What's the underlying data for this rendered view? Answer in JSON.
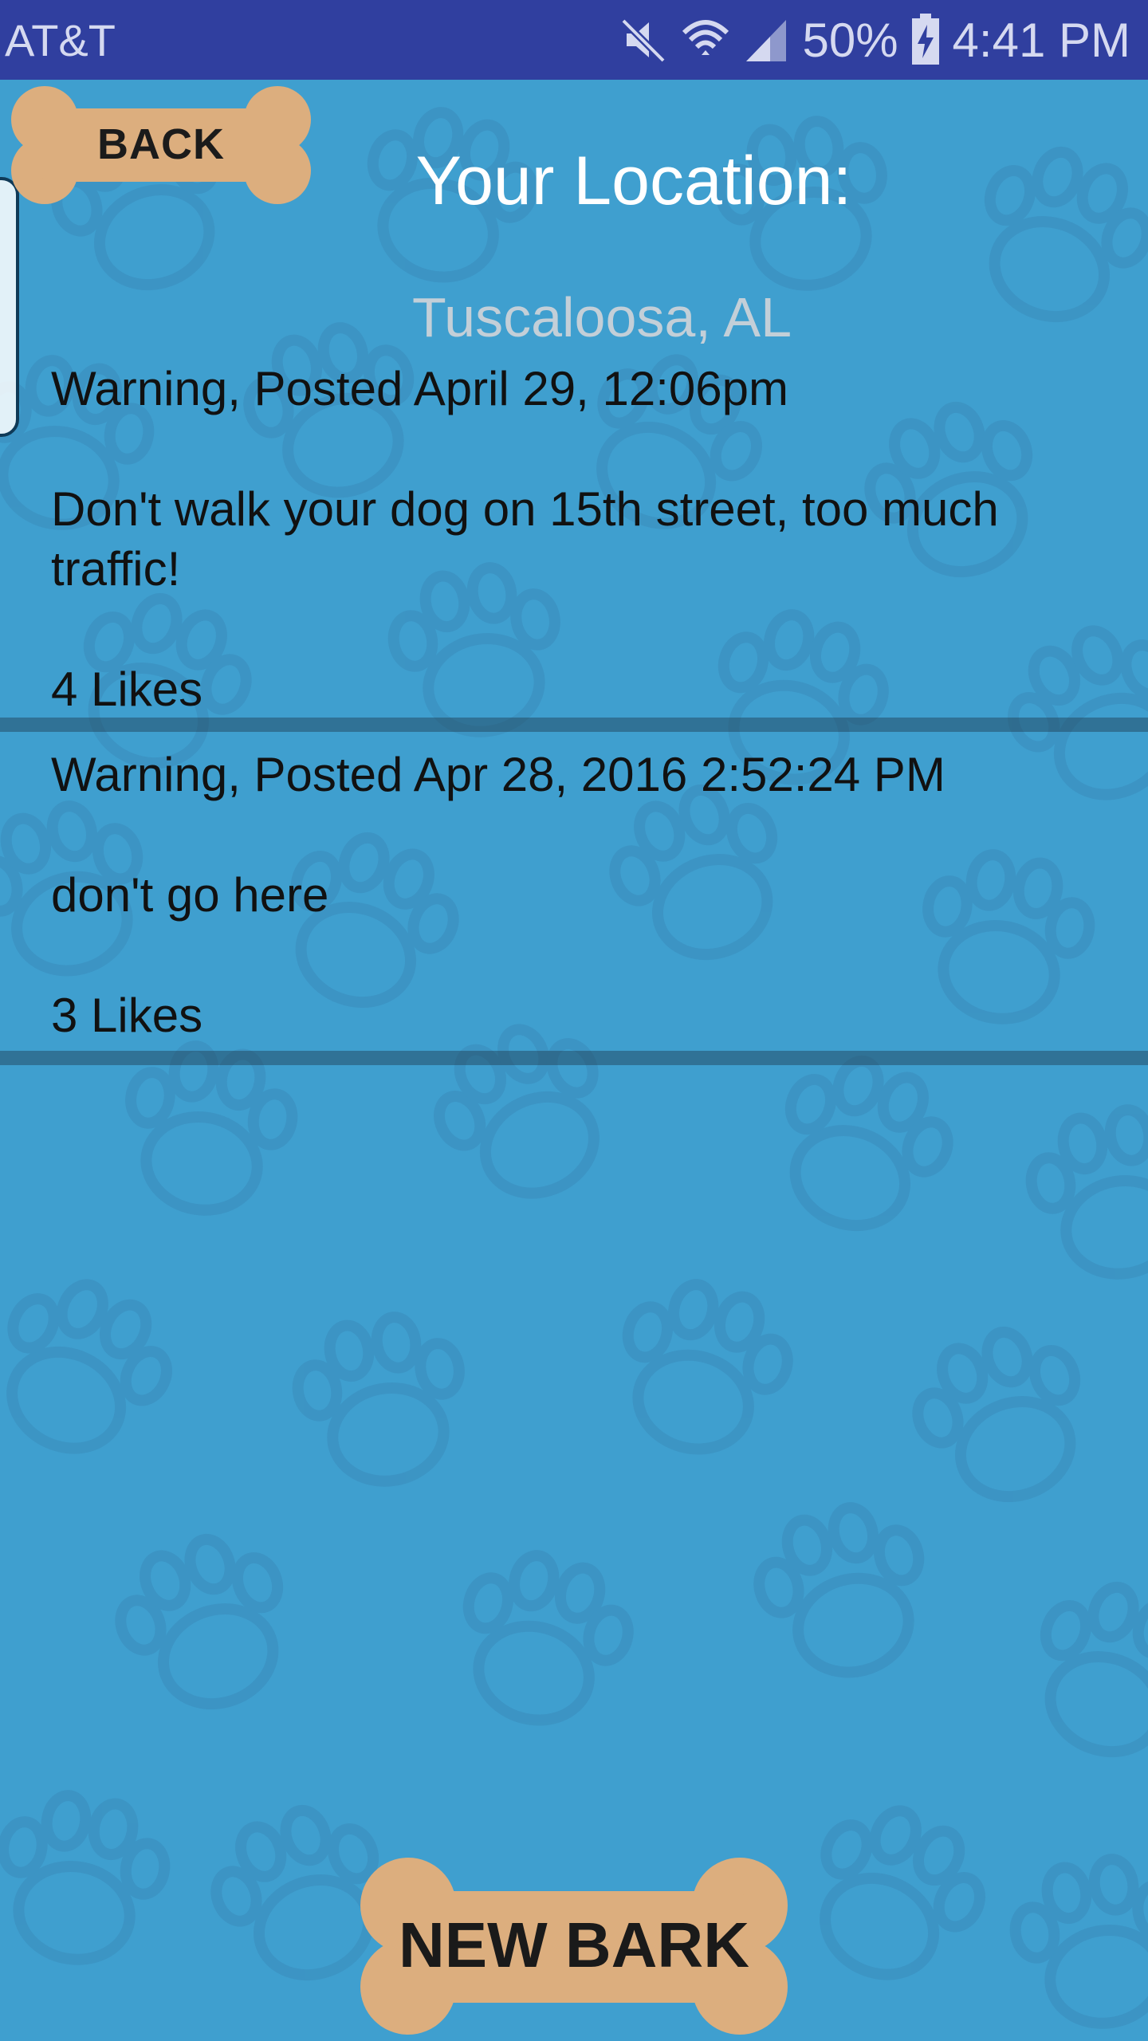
{
  "status_bar": {
    "carrier": "AT&T",
    "battery": "50%",
    "time": "4:41 PM",
    "icons": [
      "mute-icon",
      "wifi-icon",
      "signal-icon",
      "battery-charging-icon"
    ]
  },
  "header": {
    "back_label": "BACK",
    "title": "Your Location:",
    "location": "Tuscaloosa, AL"
  },
  "posts": [
    {
      "header": "Warning, Posted April 29, 12:06pm",
      "body_line1": "Don't walk your dog on 15th street, too much",
      "body_line2": "traffic!",
      "likes": "4 Likes"
    },
    {
      "header": "Warning, Posted Apr 28, 2016 2:52:24 PM",
      "body_line1": "don't go here",
      "likes": "3 Likes"
    }
  ],
  "footer": {
    "new_bark_label": "NEW BARK"
  },
  "colors": {
    "background": "#3f9fcf",
    "status_bar": "#303f9f",
    "bone": "#dcae7e",
    "paw_outline": "#3a8cbc"
  }
}
